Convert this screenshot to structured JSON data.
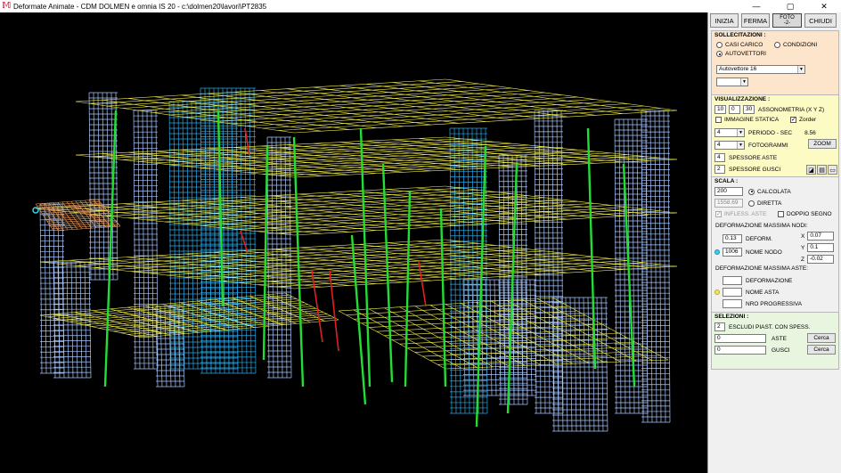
{
  "window": {
    "title": "Deformate Animate - CDM DOLMEN e omnia IS 20 - c:\\dolmen20\\lavori\\PT2835",
    "min": "—",
    "max": "▢",
    "close": "✕",
    "icon": "dolmen-logo-icon"
  },
  "toolbar": {
    "inizia": "INIZIA",
    "ferma": "FERMA",
    "pressed_line1": "FOTO",
    "pressed_line2": "-2-",
    "chiudi": "CHIUDI"
  },
  "sollecitazioni": {
    "title": "SOLLECITAZIONI :",
    "casi_carico": "CASI CARICO",
    "condizioni": "CONDIZIONI",
    "autovettori": "AUTOVETTORI",
    "selected": "AUTOVETTORI",
    "select_value": "Autovettore 16",
    "select2_value": ""
  },
  "visualizzazione": {
    "title": "VISUALIZZAZIONE :",
    "x": "10",
    "y": "0",
    "z": "30",
    "assonometria_label": "ASSONOMETRIA (X Y Z)",
    "immagine_statica": "IMMAGINE STATICA",
    "immagine_statica_checked": false,
    "zorder": "Zorder",
    "zorder_checked": true,
    "periodo_value": "4",
    "periodo_label": "PERIODO - SEC",
    "periodo_sec": "8.56",
    "fotogrammi_value": "4",
    "fotogrammi_label": "FOTOGRAMMI",
    "zoom": "ZOOM",
    "spessore_aste_value": "4",
    "spessore_aste_label": "SPESSORE ASTE",
    "spessore_gusci_value": "2",
    "spessore_gusci_label": "SPESSORE GUSCI"
  },
  "scala": {
    "title": "SCALA :",
    "value": "200",
    "calcolata": "CALCOLATA",
    "diretta_value": "1558.69",
    "diretta": "DIRETTA",
    "selected": "CALCOLATA",
    "infless_aste": "INFLESS. ASTE",
    "doppio_segno": "DOPPIO SEGNO",
    "def_max_nodi": "DEFORMAZIONE MASSIMA NODI:",
    "deform_value": "0.13",
    "deform_label": "DEFORM.",
    "x_label": "X",
    "x_value": "0.07",
    "y_label": "Y",
    "y_value": "0.1",
    "z_label": "Z",
    "z_value": "-0.02",
    "nodo_value": "1006",
    "nodo_label": "NOME NODO",
    "def_max_aste": "DEFORMAZIONE MASSIMA ASTE:",
    "aste_deform_value": "",
    "aste_deform_label": "DEFORMAZIONE",
    "asta_value": "",
    "asta_label": "NOME ASTA",
    "nrd_value": "",
    "nrd_label": "NRO PROGRESSIVA"
  },
  "selezioni": {
    "title": "SELEZIONI :",
    "escludi_value": "2",
    "escludi_label": "ESCLUDI PIAST. CON SPESS.",
    "aste_value": "0",
    "aste_label": "ASTE",
    "gusci_value": "0",
    "gusci_label": "GUSCI",
    "cerca": "Cerca"
  },
  "colors": {
    "viewport_bg": "#000000",
    "slab": "#f5f04a",
    "wall": "#a8c8ff",
    "core": "#2aa8e8",
    "column": "#22dd33",
    "beam_red": "#e02020",
    "slab_warm": "#f0a060",
    "sollecitazioni_bg": "#fde5cc",
    "visualizzazione_bg": "#fdfbc4",
    "selezioni_bg": "#e8f6e0"
  }
}
